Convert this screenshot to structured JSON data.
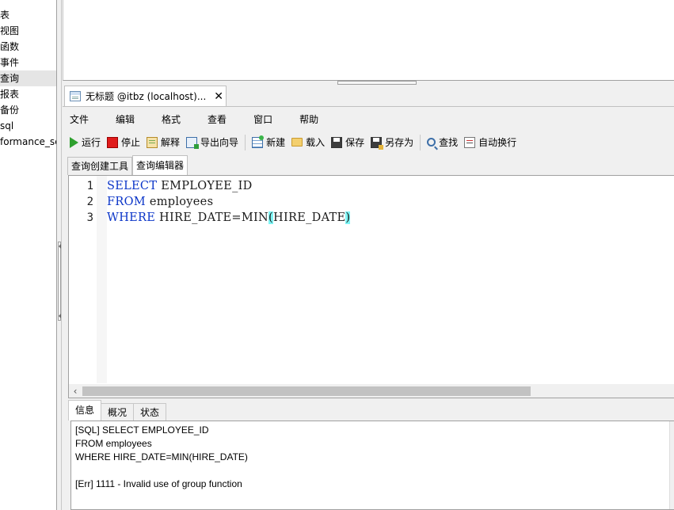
{
  "sidebar": {
    "items": [
      {
        "label": "表"
      },
      {
        "label": "视图"
      },
      {
        "label": "函数"
      },
      {
        "label": "事件"
      },
      {
        "label": "查询",
        "selected": true
      },
      {
        "label": "报表"
      },
      {
        "label": "备份"
      },
      {
        "label": "sql"
      },
      {
        "label": "formance_sc"
      }
    ]
  },
  "document_tab": {
    "title": "无标题 @itbz (localhost)...",
    "close_glyph": "✕"
  },
  "menu": {
    "items": [
      "文件",
      "编辑",
      "格式",
      "查看",
      "窗口",
      "帮助"
    ]
  },
  "toolbar": {
    "run": "运行",
    "stop": "停止",
    "explain": "解释",
    "export_wizard": "导出向导",
    "new": "新建",
    "load": "载入",
    "save": "保存",
    "save_as": "另存为",
    "find": "查找",
    "word_wrap": "自动换行"
  },
  "subtabs": {
    "query_builder": "查询创建工具",
    "query_editor": "查询编辑器",
    "active": "query_editor"
  },
  "editor": {
    "lines": [
      {
        "no": "1",
        "kw": "SELECT",
        "rest": " EMPLOYEE_ID"
      },
      {
        "no": "2",
        "kw": "FROM",
        "rest": " employees"
      },
      {
        "no": "3",
        "kw": "WHERE",
        "rest": " HIRE_DATE=MIN",
        "paren_open": "(",
        "inner": "HIRE_DATE",
        "paren_close": ")"
      }
    ],
    "keyword_color": "#0b35c8",
    "bracket_highlight_color": "#7ff5f5"
  },
  "result_tabs": {
    "info": "信息",
    "overview": "概况",
    "status": "状态",
    "active": "info"
  },
  "messages": {
    "lines": [
      "[SQL] SELECT EMPLOYEE_ID",
      "FROM employees",
      "WHERE HIRE_DATE=MIN(HIRE_DATE)",
      "",
      "[Err] 1111 - Invalid use of group function"
    ]
  }
}
